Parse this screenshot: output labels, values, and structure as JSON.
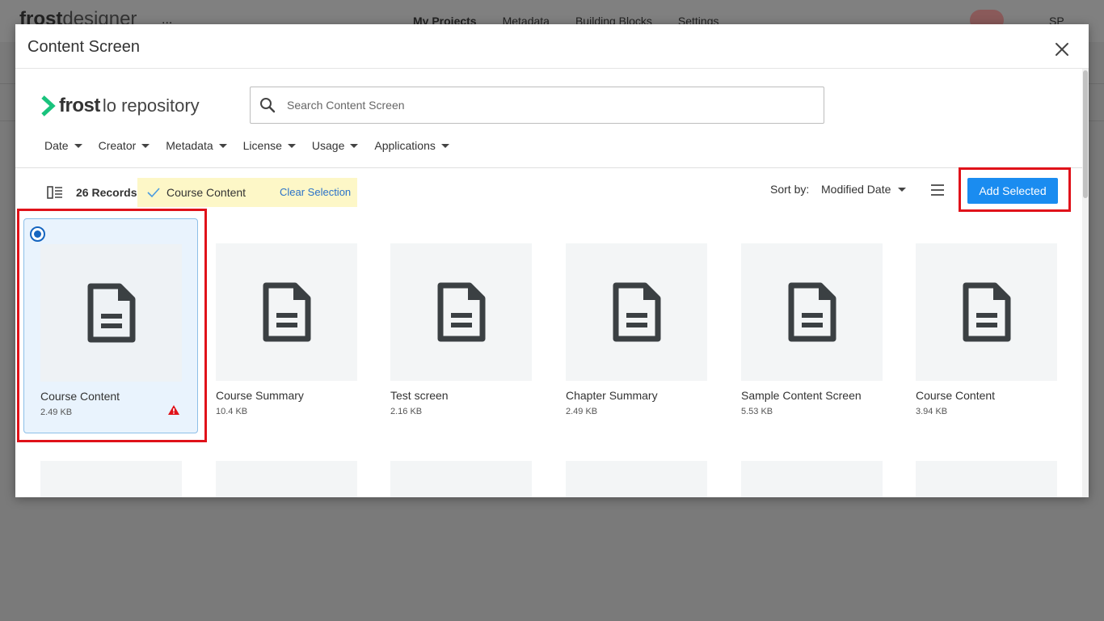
{
  "background": {
    "logo_bold": "frost",
    "logo_rest": "designer",
    "dots": "...",
    "nav": [
      "My Projects",
      "Metadata",
      "Building Blocks",
      "Settings"
    ],
    "user_initials": "SP"
  },
  "modal": {
    "title": "Content Screen",
    "brand_name": "frost",
    "brand_sub": "lo repository"
  },
  "search": {
    "placeholder": "Search Content Screen",
    "value": ""
  },
  "filters": [
    {
      "label": "Date"
    },
    {
      "label": "Creator"
    },
    {
      "label": "Metadata"
    },
    {
      "label": "License"
    },
    {
      "label": "Usage"
    },
    {
      "label": "Applications"
    }
  ],
  "toolbar": {
    "records": "26 Records",
    "selected_item": "Course Content",
    "clear_label": "Clear Selection",
    "sort_label": "Sort by:",
    "sort_value": "Modified Date",
    "add_label": "Add Selected"
  },
  "cards": [
    {
      "name": "Course Content",
      "size": "2.49 KB",
      "selected": true,
      "warning": true
    },
    {
      "name": "Course Summary",
      "size": "10.4 KB",
      "selected": false,
      "warning": false
    },
    {
      "name": "Test screen",
      "size": "2.16 KB",
      "selected": false,
      "warning": false
    },
    {
      "name": "Chapter Summary",
      "size": "2.49 KB",
      "selected": false,
      "warning": false
    },
    {
      "name": "Sample Content Screen",
      "size": "5.53 KB",
      "selected": false,
      "warning": false
    },
    {
      "name": "Course Content",
      "size": "3.94 KB",
      "selected": false,
      "warning": false
    }
  ],
  "colors": {
    "accent": "#1a8cf0",
    "highlight": "#e0121a",
    "selection_chip": "#fdf7c7",
    "link": "#2a72c8",
    "warning": "#e0121a"
  }
}
